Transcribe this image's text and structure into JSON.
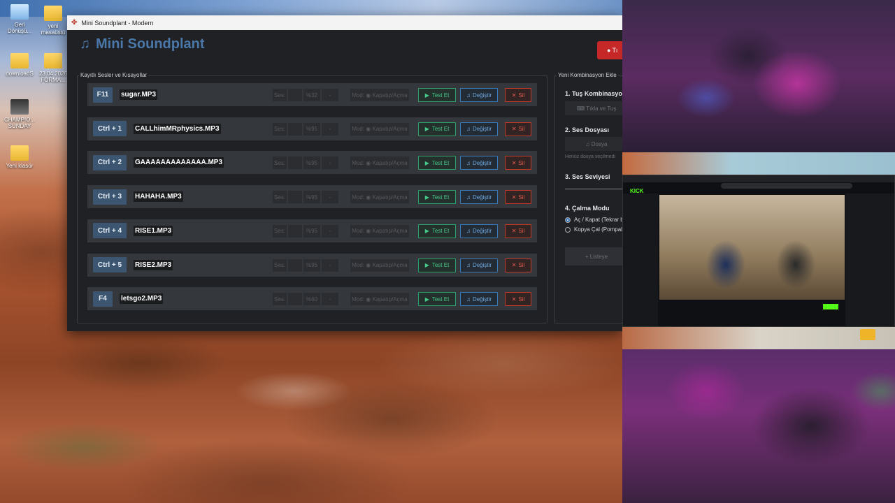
{
  "desktop": {
    "icons": [
      {
        "label": "Geri\nDönüşü...",
        "type": "recycle"
      },
      {
        "label": "yeni\nmasaüstü",
        "type": "folder"
      },
      {
        "label": "downloadS",
        "type": "folder"
      },
      {
        "label": "23.04.2026\nFORMA...",
        "type": "folder"
      },
      {
        "label": "CHAMPIO...\nSUNDAY",
        "type": "thumb"
      },
      {
        "label": "Yeni klasör",
        "type": "folder"
      }
    ]
  },
  "window": {
    "title": "Mini Soundplant - Modern",
    "app_title": "Mini Soundplant",
    "record_label": "Tı"
  },
  "sound_list": {
    "group_label": "Kayıtlı Sesler ve Kısayollar",
    "rows": [
      {
        "key": "F11",
        "file": "sugar.MP3",
        "volume_label": "Ses:",
        "volume": "%32",
        "mode": "Mod: ◉ Kapatıp/Açma",
        "test": "Test Et",
        "change": "Değiştir",
        "delete": "Sil"
      },
      {
        "key": "Ctrl + 1",
        "file": "CALLhimMRphysics.MP3",
        "volume_label": "Ses:",
        "volume": "%95",
        "mode": "Mod: ◉ Kapatıp/Açma",
        "test": "Test Et",
        "change": "Değiştir",
        "delete": "Sil"
      },
      {
        "key": "Ctrl + 2",
        "file": "GAAAAAAAAAAAAA.MP3",
        "volume_label": "Ses:",
        "volume": "%95",
        "mode": "Mod: ◉ Kapatıp/Açma",
        "test": "Test Et",
        "change": "Değiştir",
        "delete": "Sil"
      },
      {
        "key": "Ctrl + 3",
        "file": "HAHAHA.MP3",
        "volume_label": "Ses:",
        "volume": "%95",
        "mode": "Mod: ◉ Kapatıp/Açma",
        "test": "Test Et",
        "change": "Değiştir",
        "delete": "Sil"
      },
      {
        "key": "Ctrl + 4",
        "file": "RISE1.MP3",
        "volume_label": "Ses:",
        "volume": "%95",
        "mode": "Mod: ◉ Kapatıp/Açma",
        "test": "Test Et",
        "change": "Değiştir",
        "delete": "Sil"
      },
      {
        "key": "Ctrl + 5",
        "file": "RISE2.MP3",
        "volume_label": "Ses:",
        "volume": "%95",
        "mode": "Mod: ◉ Kapatıp/Açma",
        "test": "Test Et",
        "change": "Değiştir",
        "delete": "Sil"
      },
      {
        "key": "F4",
        "file": "letsgo2.MP3",
        "volume_label": "Ses:",
        "volume": "%60",
        "mode": "Mod: ◉ Kapatıp/Açma",
        "test": "Test Et",
        "change": "Değiştir",
        "delete": "Sil"
      }
    ]
  },
  "new_combo": {
    "group_label": "Yeni Kombinasyon Ekle",
    "step1_title": "1. Tuş Kombinasyon",
    "step1_button": "⌨ Tıkla ve Tuş",
    "step2_title": "2. Ses Dosyası",
    "step2_button": "♫ Dosya",
    "step2_hint": "Henüz dosya seçilmedi",
    "step3_title": "3. Ses Seviyesi",
    "step4_title": "4. Çalma Modu",
    "mode_option1": "Aç / Kapat (Tekrar b",
    "mode_option2": "Kopya Çal (Pompala",
    "add_button": "+ Listeye"
  },
  "stream": {
    "site_logo": "KICK"
  },
  "colors": {
    "accent": "#4b78a8",
    "test": "#46c98b",
    "change": "#6fa9e0",
    "delete": "#e05a4c",
    "record": "#c62828"
  }
}
